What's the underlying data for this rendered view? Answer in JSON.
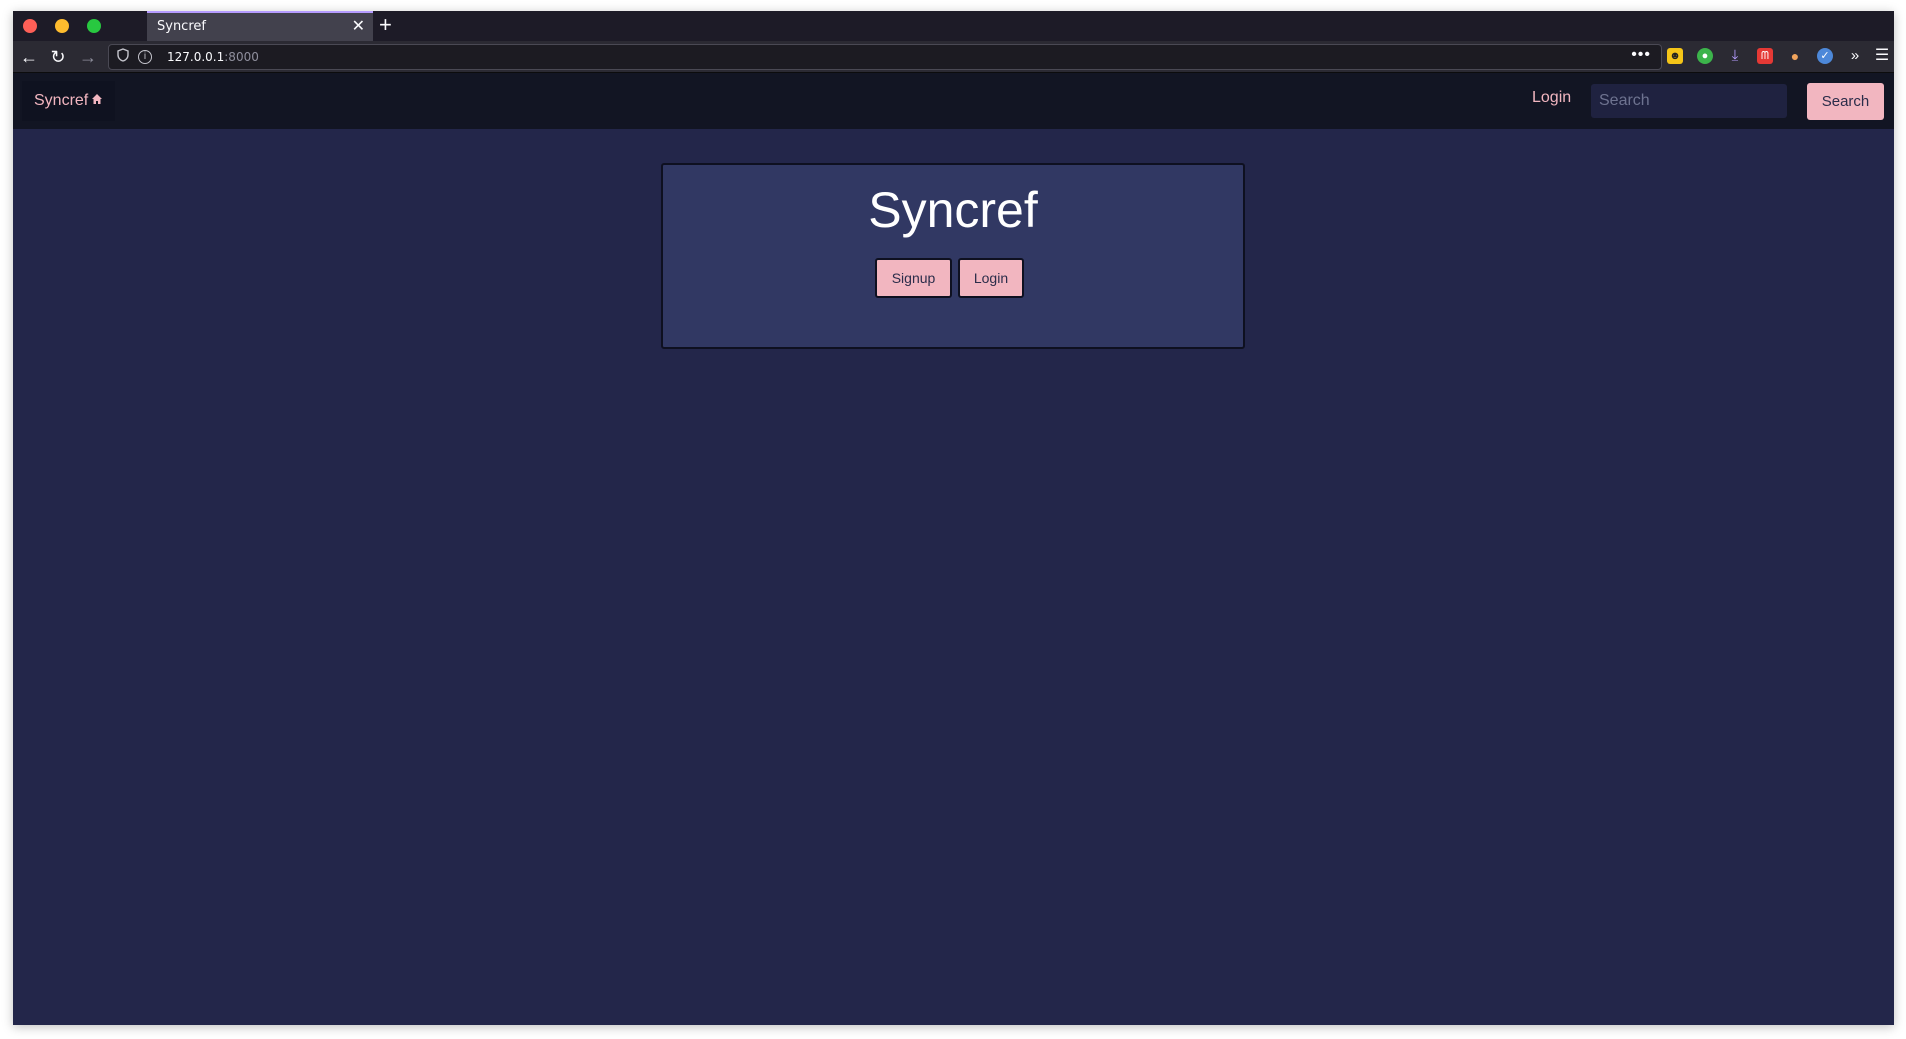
{
  "browser": {
    "tab_title": "Syncref",
    "tab_close": "✕",
    "new_tab": "+",
    "url_host": "127.0.0.1",
    "url_port": ":8000",
    "url_more": "•••",
    "nav": {
      "back": "←",
      "reload": "↻",
      "forward": "→"
    },
    "extensions": [
      "smiley-icon",
      "green-circle-icon",
      "download-icon",
      "red-mask-icon",
      "orange-drop-icon",
      "blue-check-icon",
      "overflow-chevron-icon",
      "hamburger-menu-icon"
    ]
  },
  "site": {
    "brand": "Syncref",
    "brand_icon": "home-icon",
    "nav_login": "Login",
    "search_placeholder": "Search",
    "search_button": "Search"
  },
  "hero": {
    "title": "Syncref",
    "signup_label": "Signup",
    "login_label": "Login"
  },
  "colors": {
    "page_bg": "#23264a",
    "nav_bg": "#121523",
    "hero_bg": "#313863",
    "accent_pink": "#f2b6c0"
  }
}
